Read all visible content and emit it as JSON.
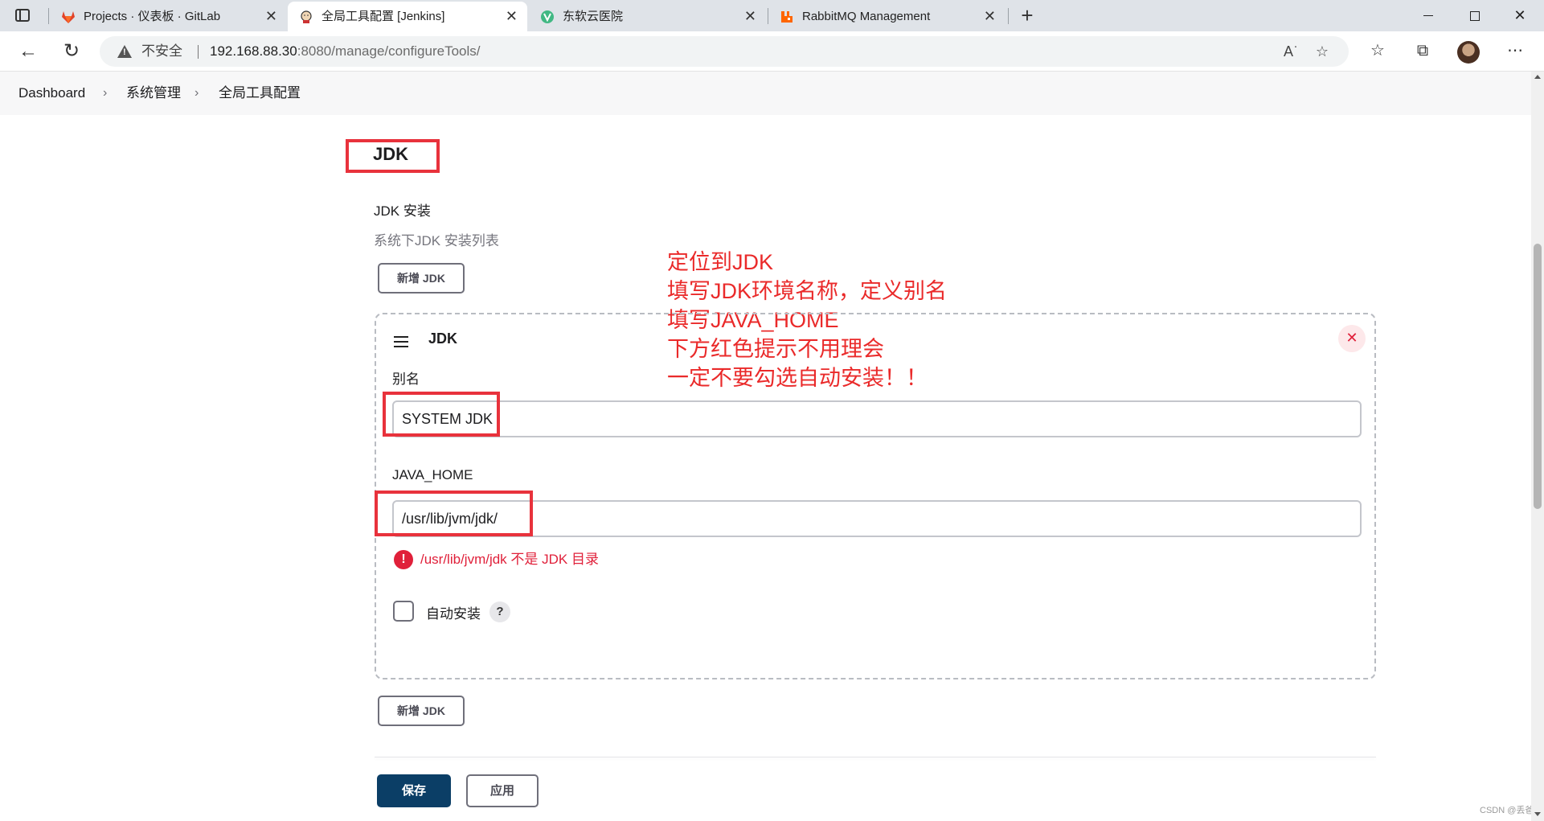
{
  "browser": {
    "tabs": [
      {
        "title": "Projects · 仪表板 · GitLab",
        "icon": "gitlab-icon",
        "active": false
      },
      {
        "title": "全局工具配置 [Jenkins]",
        "icon": "jenkins-icon",
        "active": true
      },
      {
        "title": "东软云医院",
        "icon": "vue-icon",
        "active": false
      },
      {
        "title": "RabbitMQ Management",
        "icon": "rabbitmq-icon",
        "active": false
      }
    ],
    "close_glyph": "✕",
    "new_tab_glyph": "+",
    "security_label": "不安全",
    "url_host": "192.168.88.30",
    "url_rest": ":8080/manage/configureTools/"
  },
  "breadcrumb": {
    "items": [
      "Dashboard",
      "系统管理",
      "全局工具配置"
    ],
    "separator": "›"
  },
  "jdk_section": {
    "title": "JDK",
    "install_label": "JDK 安装",
    "install_description": "系统下JDK 安装列表",
    "add_button_top": "新增 JDK",
    "add_button_bottom": "新增 JDK",
    "card": {
      "title": "JDK",
      "delete_glyph": "✕",
      "alias_label": "别名",
      "alias_value": "SYSTEM JDK",
      "java_home_label": "JAVA_HOME",
      "java_home_value": "/usr/lib/jvm/jdk/",
      "error_glyph": "!",
      "error_message": "/usr/lib/jvm/jdk 不是 JDK 目录",
      "auto_install_label": "自动安装",
      "auto_install_checked": false,
      "help_glyph": "?"
    }
  },
  "annotation": {
    "lines": [
      "定位到JDK",
      "填写JDK环境名称，定义别名",
      "填写JAVA_HOME",
      "下方红色提示不用理会",
      "一定不要勾选自动安装！！"
    ],
    "color": "#ea2a2a"
  },
  "footer": {
    "save_label": "保存",
    "apply_label": "应用"
  },
  "watermark": "CSDN @丢爸",
  "colors": {
    "primary": "#0b3e66",
    "error": "#e0203a",
    "highlight_box": "#e8323c"
  }
}
